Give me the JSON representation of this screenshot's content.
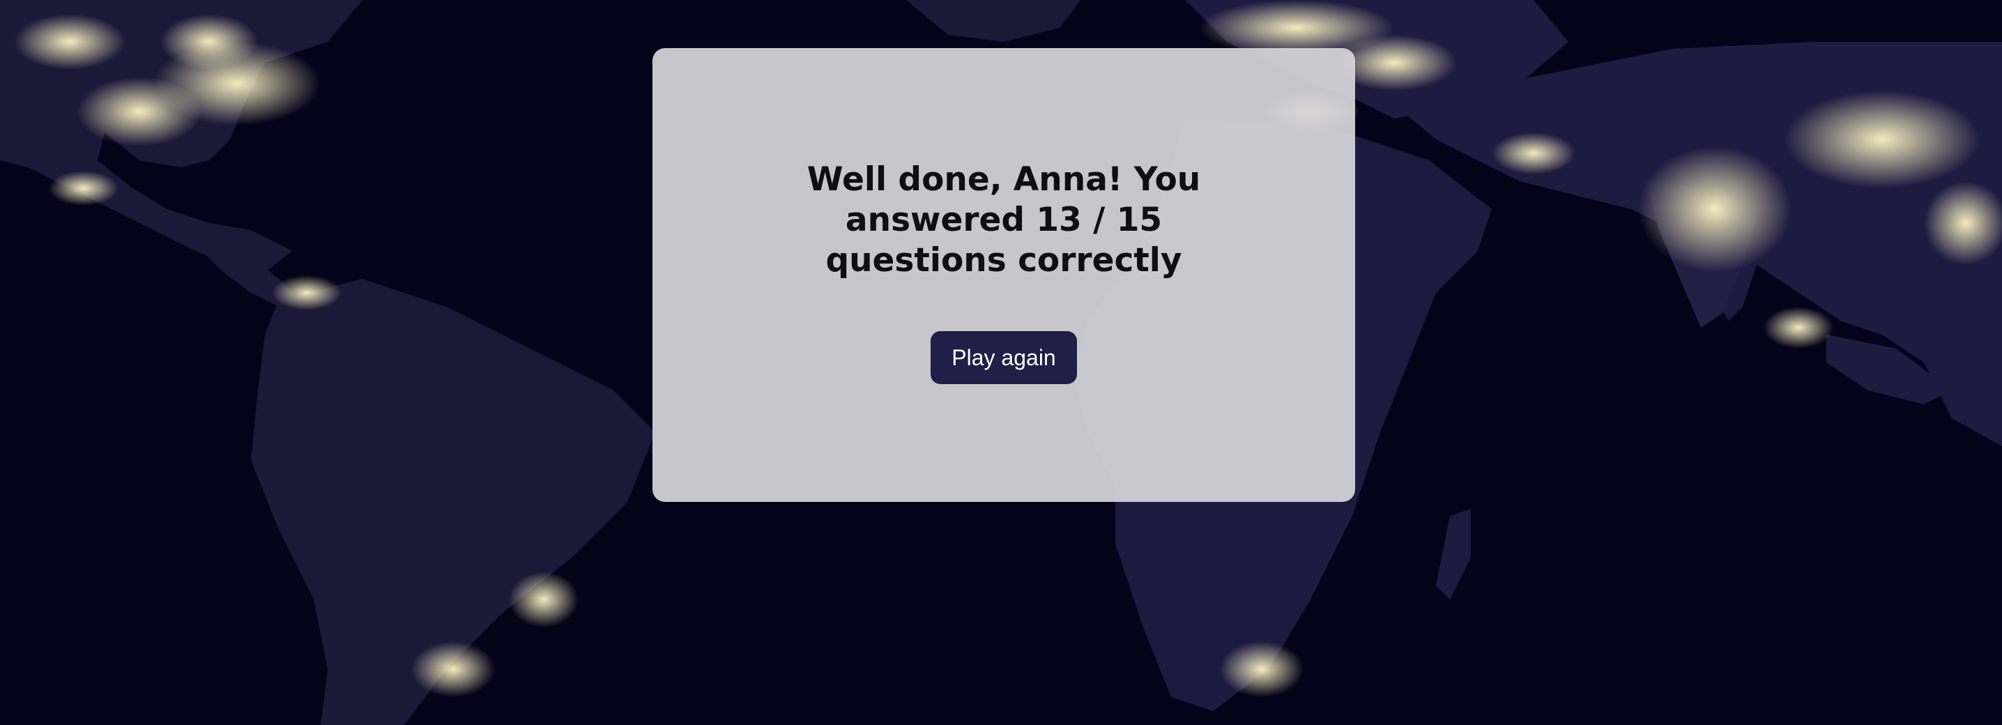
{
  "result": {
    "message": "Well done, Anna! You answered 13 / 15 questions correctly",
    "play_again_label": "Play again"
  },
  "colors": {
    "background": "#05031a",
    "card": "#d6d5da",
    "button": "#1f1f47",
    "button_text": "#ffffff",
    "message_text": "#0e0e14",
    "city_lights": "#f4efc0"
  },
  "background_image": "world-map-at-night"
}
